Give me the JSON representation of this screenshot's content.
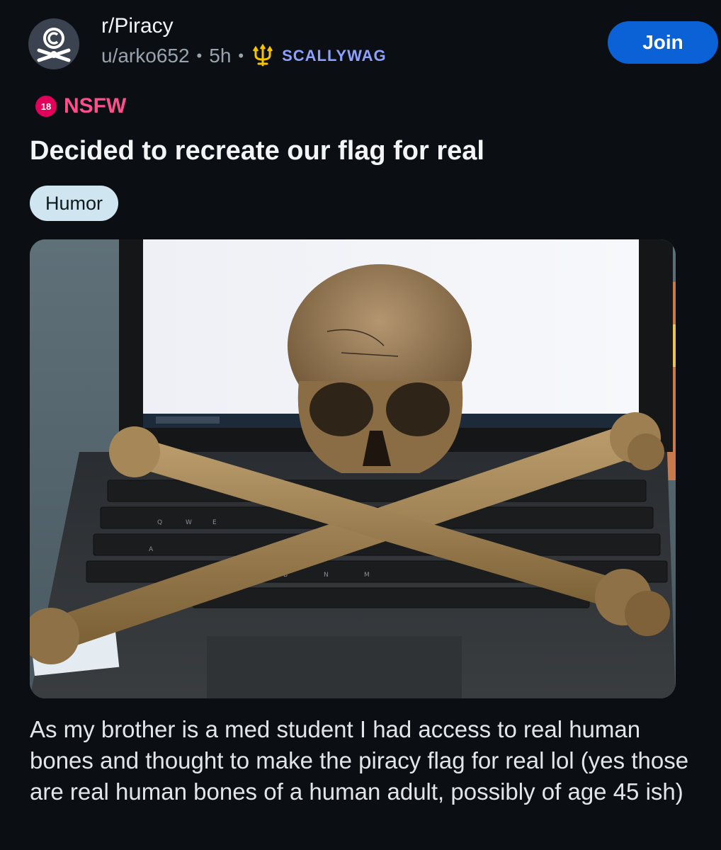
{
  "header": {
    "subreddit": "r/Piracy",
    "username": "u/arko652",
    "age": "5h",
    "separator": "•",
    "user_flair": "SCALLYWAG",
    "join_label": "Join",
    "avatar_icon": "jolly-roger-copyright-icon",
    "flair_icon": "trident-icon"
  },
  "nsfw": {
    "badge": "18",
    "label": "NSFW"
  },
  "post": {
    "title": "Decided to recreate our flag for real",
    "flair": "Humor",
    "body": "As my brother is a med student I had access to real human bones and thought to make the piracy flag for real lol (yes those are real human bones of a human adult, possibly of age 45 ish)"
  },
  "image": {
    "keyboard_keys": [
      "Q",
      "W",
      "E",
      "A",
      "B",
      "N",
      "M"
    ]
  },
  "colors": {
    "background": "#0b0f14",
    "join": "#0b62d6",
    "nsfw": "#e2005a",
    "flair_bg": "#cfe5f0",
    "user_flair": "#8da2ff"
  }
}
